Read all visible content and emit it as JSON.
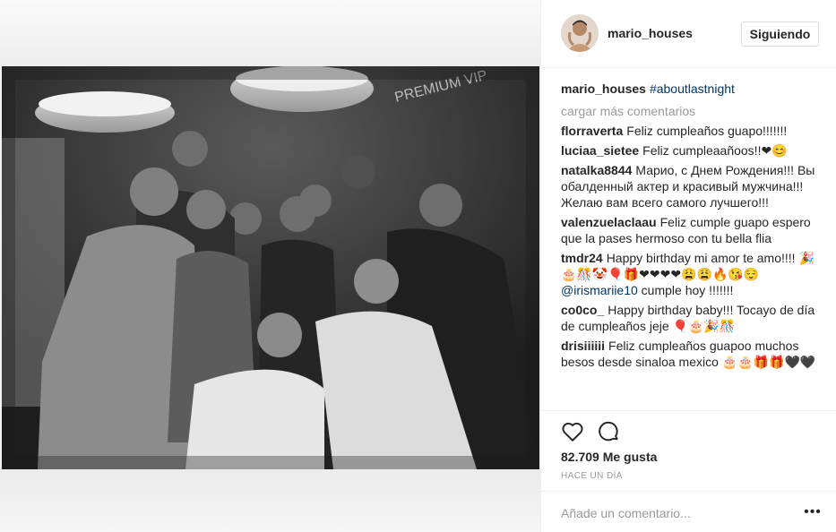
{
  "post": {
    "username": "mario_houses",
    "follow_label": "Siguiendo",
    "caption_username": "mario_houses",
    "caption_hashtag": "#aboutlastnight",
    "load_more": "cargar más comentarios",
    "photo_sign_text": "PREMIUM VIP"
  },
  "comments": [
    {
      "user": "florraverta",
      "text": "Feliz cumpleaños guapo!!!!!!!"
    },
    {
      "user": "luciaa_sietee",
      "text": "Feliz cumpleaañoos!!❤😊"
    },
    {
      "user": "natalka8844",
      "text": "Марио, с Днем Рождения!!! Вы обалденный актер и красивый мужчина!!! Желаю вам всего самого лучшего!!!"
    },
    {
      "user": "valenzuelaclaau",
      "text": "Feliz cumple guapo espero que la pases hermoso con tu bella flia"
    },
    {
      "user": "tmdr24",
      "text": "Happy birthday mi amor te amo!!!! 🎉🎂🎊🤡🎈🎁❤❤❤❤😩😩🔥😘😌"
    },
    {
      "mention": "@irismariie10",
      "text": " cumple hoy !!!!!!!"
    },
    {
      "user": "co0co_",
      "text": "Happy birthday baby!!! Tocayo de día de cumpleaños jeje 🎈🎂🎉🎊"
    },
    {
      "user": "drisiiiiii",
      "text": "Feliz cumpleaños guapoo muchos besos desde sinaloa mexico 🎂🎂🎁🎁🖤🖤"
    }
  ],
  "actions": {
    "like_icon": "heart-icon",
    "comment_icon": "comment-icon",
    "likes_text": "82.709 Me gusta",
    "timestamp": "HACE UN DÍA"
  },
  "add_comment": {
    "placeholder": "Añade un comentario...",
    "more_label": "•••"
  }
}
